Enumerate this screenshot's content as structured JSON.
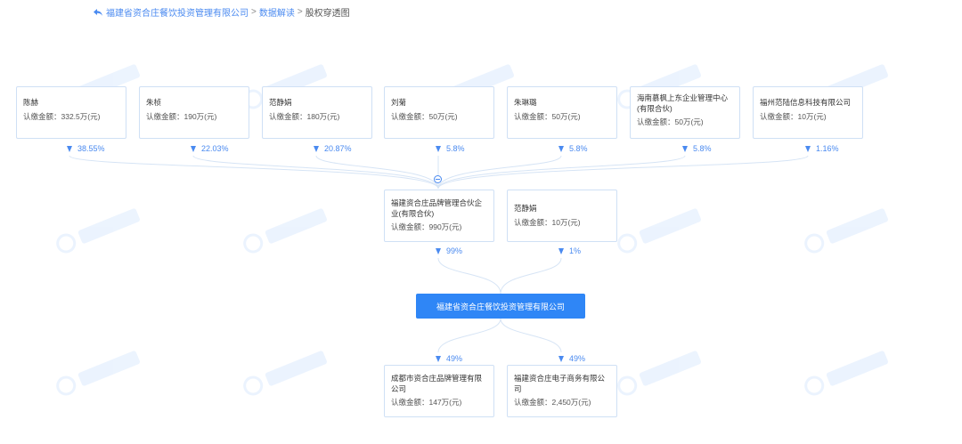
{
  "breadcrumb": {
    "company": "福建省资合庄餐饮投资管理有限公司",
    "sep": ">",
    "section": "数据解读",
    "current": "股权穿透图"
  },
  "shareholders": [
    {
      "name": "陈赫",
      "amount": "认缴金额：332.5万(元)",
      "pct": "38.55%"
    },
    {
      "name": "朱桢",
      "amount": "认缴金额：190万(元)",
      "pct": "22.03%"
    },
    {
      "name": "范静娟",
      "amount": "认缴金额：180万(元)",
      "pct": "20.87%"
    },
    {
      "name": "刘菊",
      "amount": "认缴金额：50万(元)",
      "pct": "5.8%"
    },
    {
      "name": "朱琳璐",
      "amount": "认缴金额：50万(元)",
      "pct": "5.8%"
    },
    {
      "name": "海南慕枫上东企业管理中心(有限合伙)",
      "amount": "认缴金额：50万(元)",
      "pct": "5.8%"
    },
    {
      "name": "福州范陆信息科技有限公司",
      "amount": "认缴金额：10万(元)",
      "pct": "1.16%"
    }
  ],
  "mid_shareholders": [
    {
      "name": "福建资合庄品牌管理合伙企业(有限合伙)",
      "amount": "认缴金额：990万(元)",
      "pct": "99%"
    },
    {
      "name": "范静娟",
      "amount": "认缴金额：10万(元)",
      "pct": "1%"
    }
  ],
  "center": {
    "name": "福建省资合庄餐饮投资管理有限公司"
  },
  "investments": [
    {
      "name": "成都市资合庄品牌管理有限公司",
      "amount": "认缴金额：147万(元)",
      "pct": "49%"
    },
    {
      "name": "福建资合庄电子商务有限公司",
      "amount": "认缴金额：2,450万(元)",
      "pct": "49%"
    }
  ],
  "colors": {
    "accent": "#2f86f6",
    "link": "#4a8af0",
    "border": "#cfe0f5"
  },
  "icons": {
    "back": "back-arrow-icon",
    "collapse": "collapse-toggle-icon",
    "arrow": "down-arrow-icon"
  }
}
